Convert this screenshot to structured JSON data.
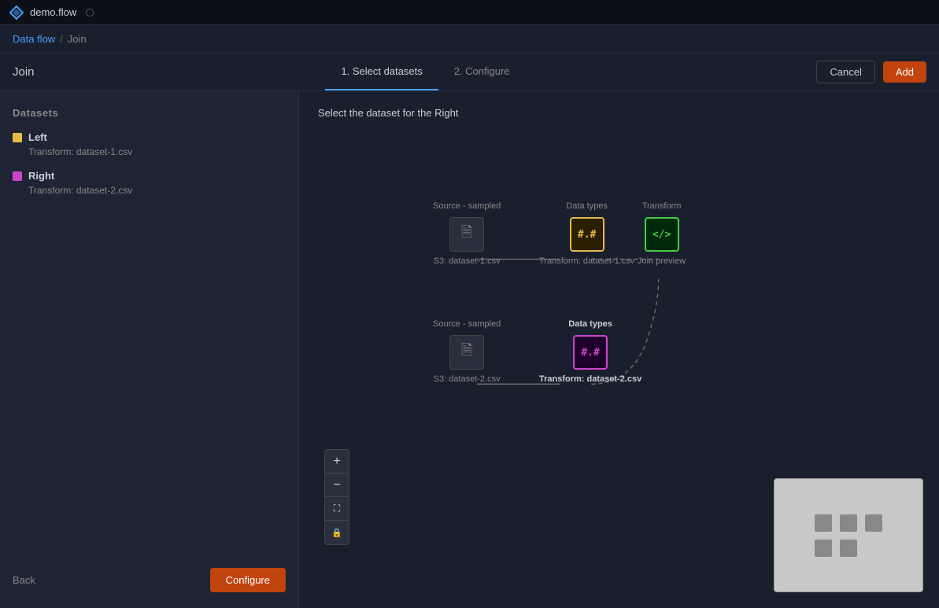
{
  "titlebar": {
    "app_name": "demo.flow"
  },
  "breadcrumb": {
    "link": "Data flow",
    "separator": "/",
    "current": "Join"
  },
  "page": {
    "title": "Join"
  },
  "tabs": [
    {
      "label": "1. Select datasets",
      "active": true
    },
    {
      "label": "2. Configure",
      "active": false
    }
  ],
  "actions": {
    "cancel_label": "Cancel",
    "add_label": "Add"
  },
  "left_panel": {
    "title": "Datasets",
    "datasets": [
      {
        "name": "Left",
        "color": "yellow",
        "subtitle": "Transform: dataset-1.csv"
      },
      {
        "name": "Right",
        "color": "purple",
        "subtitle": "Transform: dataset-2.csv"
      }
    ],
    "back_label": "Back",
    "configure_label": "Configure"
  },
  "canvas": {
    "instruction": "Select the dataset for the Right",
    "row1": {
      "source_label": "Source - sampled",
      "source_caption": "S3: dataset-1.csv",
      "data_types_label": "Data types",
      "data_types_caption": "Transform: dataset-1.csv",
      "transform_label": "Transform",
      "transform_caption": "Join preview"
    },
    "row2": {
      "source_label": "Source - sampled",
      "source_caption": "S3: dataset-2.csv",
      "data_types_label": "Data types",
      "data_types_caption": "Transform: dataset-2.csv"
    }
  },
  "zoom_controls": [
    {
      "icon": "+",
      "label": "zoom-in"
    },
    {
      "icon": "−",
      "label": "zoom-out"
    },
    {
      "icon": "⛶",
      "label": "fit"
    },
    {
      "icon": "🔒",
      "label": "lock"
    }
  ]
}
